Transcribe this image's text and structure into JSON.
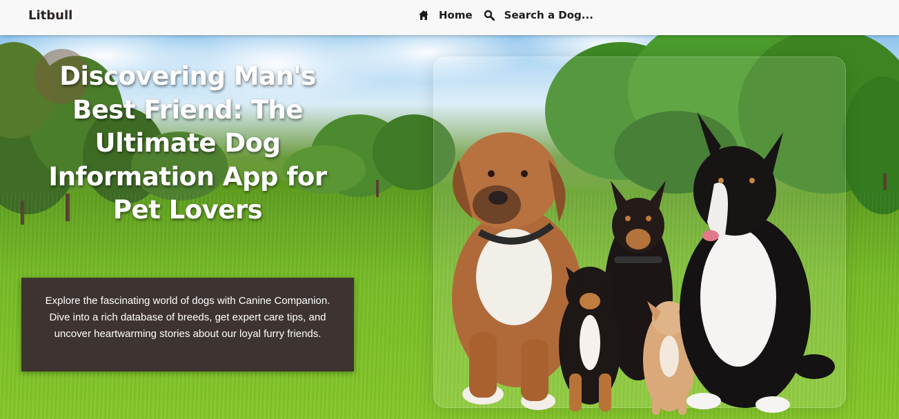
{
  "navbar": {
    "brand": "Litbull",
    "links": [
      {
        "label": "Home",
        "icon": "home-icon"
      },
      {
        "label": "Search a Dog...",
        "icon": "search-icon"
      }
    ]
  },
  "hero": {
    "title": "Discovering Man's Best Friend: The Ultimate Dog Information App for Pet Lovers",
    "description": "Explore the fascinating world of dogs with Canine Companion. Dive into a rich database of breeds, get expert care tips, and uncover heartwarming stories about our loyal furry friends."
  },
  "colors": {
    "navbar_bg": "#f8f8f9",
    "description_bg": "#3d3431",
    "title_text": "#ffffff"
  }
}
